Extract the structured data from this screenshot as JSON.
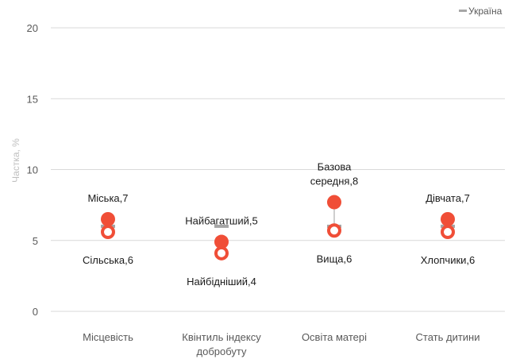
{
  "chart_data": {
    "type": "scatter",
    "ylabel": "Частка, %",
    "ylim": [
      0,
      20
    ],
    "y_ticks": [
      "0",
      "5",
      "10",
      "15",
      "20"
    ],
    "grid": true,
    "legend_position": "top-right",
    "legend": [
      {
        "name": "Україна",
        "marker": "dash",
        "color": "#a6a6a6"
      }
    ],
    "categories": [
      {
        "lines": [
          "Місцевість"
        ]
      },
      {
        "lines": [
          "Квінтиль індексу",
          "добробуту"
        ]
      },
      {
        "lines": [
          "Освіта матері"
        ]
      },
      {
        "lines": [
          "Стать дитини"
        ]
      }
    ],
    "series": [
      {
        "marker": "filled-circle",
        "color": "#f04e37",
        "points": [
          {
            "category": 0,
            "y": 6.5,
            "label": [
              "Міська,7"
            ]
          },
          {
            "category": 1,
            "y": 4.9,
            "label": [
              "Найбагатший,5"
            ]
          },
          {
            "category": 2,
            "y": 7.7,
            "label": [
              "Базова",
              "середня,8"
            ]
          },
          {
            "category": 3,
            "y": 6.5,
            "label": [
              "Дівчата,7"
            ]
          }
        ]
      },
      {
        "marker": "hollow-circle",
        "color": "#f04e37",
        "points": [
          {
            "category": 0,
            "y": 5.6,
            "label": [
              "Сільська,6"
            ]
          },
          {
            "category": 1,
            "y": 4.1,
            "label": [
              "Найбідніший,4"
            ]
          },
          {
            "category": 2,
            "y": 5.7,
            "label": [
              "Вища,6"
            ]
          },
          {
            "category": 3,
            "y": 5.6,
            "label": [
              "Хлопчики,6"
            ]
          }
        ]
      }
    ],
    "national": {
      "name": "Україна",
      "color": "#a6a6a6",
      "values": [
        6.0,
        6.0,
        6.0,
        6.0
      ]
    }
  }
}
